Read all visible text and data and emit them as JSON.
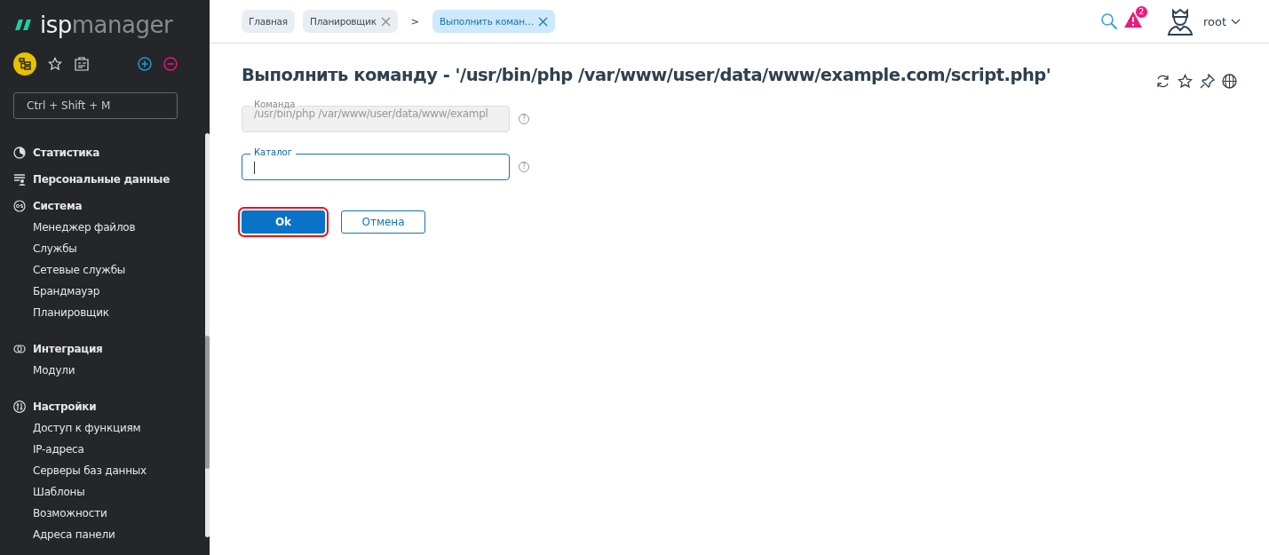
{
  "logo": {
    "brand": "isp",
    "product": "manager"
  },
  "search": {
    "placeholder": "Ctrl + Shift + M"
  },
  "menu": [
    {
      "label": "Статистика"
    },
    {
      "label": "Персональные данные"
    },
    {
      "label": "Система",
      "children": [
        {
          "label": "Менеджер файлов"
        },
        {
          "label": "Службы"
        },
        {
          "label": "Сетевые службы"
        },
        {
          "label": "Брандмауэр"
        },
        {
          "label": "Планировщик"
        }
      ]
    },
    {
      "label": "Интеграция",
      "children": [
        {
          "label": "Модули"
        }
      ]
    },
    {
      "label": "Настройки",
      "children": [
        {
          "label": "Доступ к функциям"
        },
        {
          "label": "IP-адреса"
        },
        {
          "label": "Серверы баз данных"
        },
        {
          "label": "Шаблоны"
        },
        {
          "label": "Возможности"
        },
        {
          "label": "Адреса панели"
        }
      ]
    }
  ],
  "breadcrumbs": [
    {
      "label": "Главная",
      "closable": false,
      "selected": false
    },
    {
      "label": "Планировщик",
      "closable": true,
      "selected": false
    },
    {
      "label": "Выполнить коман…",
      "closable": true,
      "selected": true
    }
  ],
  "breadcrumb_separator": ">",
  "notifications": {
    "count": "2"
  },
  "user": {
    "name": "root"
  },
  "title": "Выполнить команду - '/usr/bin/php /var/www/user/data/www/example.com/script.php'",
  "fields": [
    {
      "label": "Команда",
      "value": "/usr/bin/php /var/www/user/data/www/exampl",
      "disabled": true,
      "focused": false,
      "help": "?"
    },
    {
      "label": "Каталог",
      "disabled": false,
      "focused": true,
      "help": "?"
    }
  ],
  "buttons": [
    {
      "label": "Ok",
      "kind": "primary",
      "highlighted": true
    },
    {
      "label": "Отмена",
      "kind": "secondary",
      "highlighted": false
    }
  ]
}
